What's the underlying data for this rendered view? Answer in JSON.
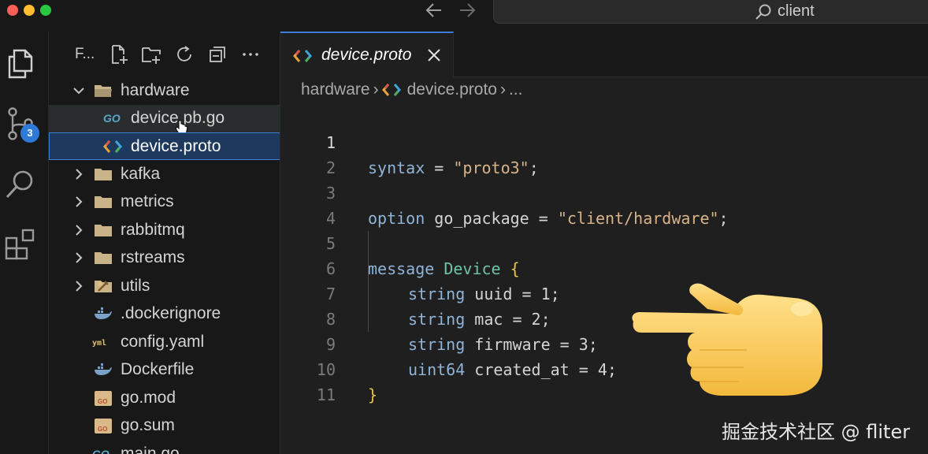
{
  "window": {
    "search_text": "client"
  },
  "activity_bar": {
    "source_control_badge": "3"
  },
  "sidebar": {
    "title": "F...",
    "items": [
      {
        "label": "hardware",
        "type": "folder",
        "expanded": true
      },
      {
        "label": "device.pb.go",
        "type": "file-go"
      },
      {
        "label": "device.proto",
        "type": "file-proto",
        "selected": true
      },
      {
        "label": "kafka",
        "type": "folder"
      },
      {
        "label": "metrics",
        "type": "folder"
      },
      {
        "label": "rabbitmq",
        "type": "folder"
      },
      {
        "label": "rstreams",
        "type": "folder"
      },
      {
        "label": "utils",
        "type": "folder-utils"
      },
      {
        "label": ".dockerignore",
        "type": "file-docker"
      },
      {
        "label": "config.yaml",
        "type": "file-yaml"
      },
      {
        "label": "Dockerfile",
        "type": "file-docker"
      },
      {
        "label": "go.mod",
        "type": "file-gomod"
      },
      {
        "label": "go.sum",
        "type": "file-gomod"
      },
      {
        "label": "main.go",
        "type": "file-go"
      }
    ]
  },
  "editor": {
    "tab_label": "device.proto",
    "breadcrumb": {
      "folder": "hardware",
      "file": "device.proto",
      "more": "..."
    },
    "line_numbers": [
      "1",
      "2",
      "3",
      "4",
      "5",
      "6",
      "7",
      "8",
      "9",
      "10",
      "11"
    ],
    "code": {
      "l1_kw": "syntax",
      "l1_eq": " = ",
      "l1_str": "\"proto3\"",
      "l1_end": ";",
      "l3_kw": "option",
      "l3_mid": " go_package = ",
      "l3_str": "\"client/hardware\"",
      "l3_end": ";",
      "l5_kw": "message",
      "l5_name": "Device",
      "l5_brace": "{",
      "l6_type": "string",
      "l6_rest": " uuid = 1;",
      "l7_type": "string",
      "l7_rest": " mac = 2;",
      "l8_type": "string",
      "l8_rest": " firmware = 3;",
      "l9_type": "uint64",
      "l9_rest": " created_at = 4;",
      "l10_brace": "}"
    }
  },
  "watermark": "掘金技术社区 @ fliter"
}
